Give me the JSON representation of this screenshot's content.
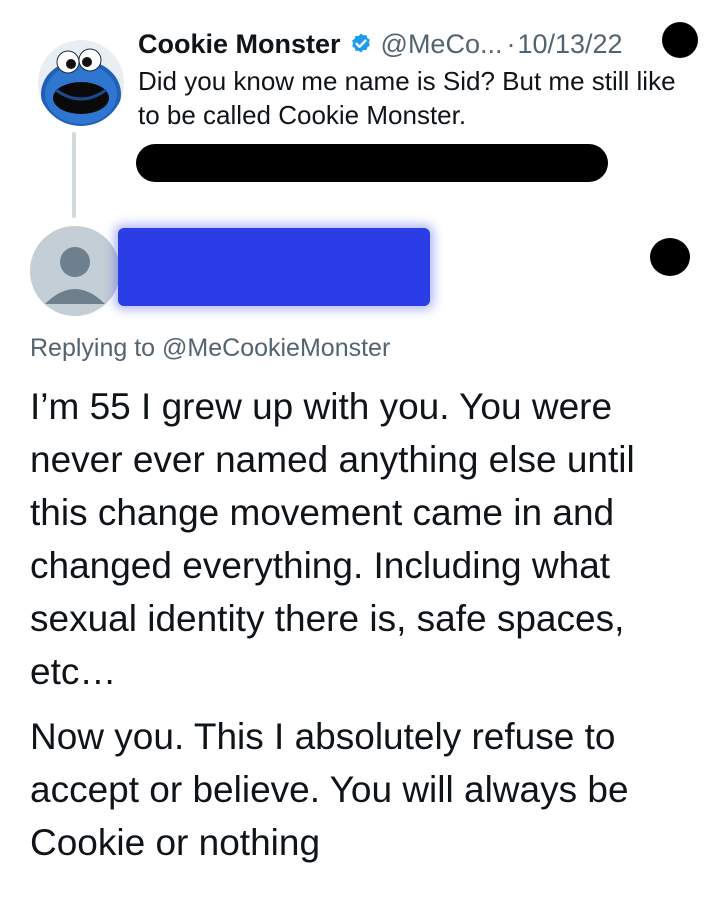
{
  "original_tweet": {
    "author_name": "Cookie Monster",
    "handle": "@MeCo...",
    "separator": "·",
    "date": "10/13/22",
    "text": "Did you know me name is Sid? But me still like to be called Cookie Monster.",
    "verified": true,
    "avatar": "cookie-monster-avatar"
  },
  "reply": {
    "avatar": "default-user-avatar",
    "replying_to_label": "Replying to",
    "replying_to_handle": "@MeCookieMonster",
    "paragraphs": [
      "I’m 55 I grew up with you. You were never ever named anything else until this change movement came in and changed everything. Including what sexual identity there is, safe spaces, etc…",
      "Now you. This I absolutely refuse to accept or believe. You will always be Cookie or nothing"
    ]
  },
  "colors": {
    "text": "#0f1419",
    "secondary_text": "#536471",
    "verified_blue": "#1d9bf0",
    "redaction_black": "#000000",
    "redaction_blue": "#2b3de6"
  }
}
